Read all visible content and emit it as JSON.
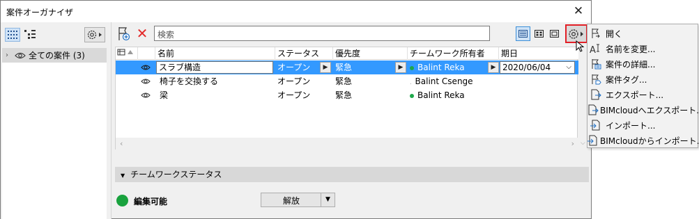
{
  "window": {
    "title": "案件オーガナイザ",
    "close_glyph": "✕"
  },
  "left": {
    "tree": [
      {
        "label": "全ての案件 (3)"
      }
    ]
  },
  "toolbar": {
    "delete_glyph": "✕",
    "search_placeholder": "検索"
  },
  "table": {
    "columns": [
      "名前",
      "ステータス",
      "優先度",
      "チームワーク所有者",
      "期日"
    ],
    "rows": [
      {
        "name": "スラブ構造",
        "status": "オープン",
        "priority": "緊急",
        "owner": "Balint Reka",
        "due": "2020/06/04",
        "owner_dot": true
      },
      {
        "name": "椅子を交換する",
        "status": "オープン",
        "priority": "緊急",
        "owner": "Balint Csenge",
        "due": "",
        "owner_dot": false
      },
      {
        "name": "梁",
        "status": "オープン",
        "priority": "緊急",
        "owner": "Balint Reka",
        "due": "",
        "owner_dot": true
      }
    ]
  },
  "teamwork": {
    "header": "チームワークステータス",
    "status": "編集可能",
    "release_label": "解放",
    "status_color": "#19a23e"
  },
  "menu": {
    "items": [
      {
        "label": "開く",
        "icon": "open-icon"
      },
      {
        "label": "名前を変更...",
        "icon": "rename-icon"
      },
      {
        "label": "案件の詳細...",
        "icon": "details-icon"
      },
      {
        "label": "案件タグ...",
        "icon": "tag-icon"
      },
      {
        "label": "エクスポート...",
        "icon": "export-icon"
      },
      {
        "label": "BIMcloudへエクスポート...",
        "icon": "export-cloud-icon"
      },
      {
        "label": "インポート...",
        "icon": "import-icon"
      },
      {
        "label": "BIMcloudからインポート...",
        "icon": "import-cloud-icon"
      }
    ]
  },
  "colors": {
    "accent": "#3399ff",
    "highlight": "#e21f26"
  }
}
